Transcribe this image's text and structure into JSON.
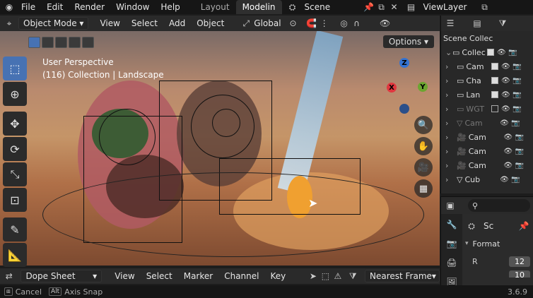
{
  "topbar": {
    "menus": [
      "File",
      "Edit",
      "Render",
      "Window",
      "Help"
    ],
    "workspaces": [
      {
        "label": "Layout",
        "active": false
      },
      {
        "label": "Modelin",
        "active": true
      }
    ],
    "scene": "Scene",
    "view_layer": "ViewLayer"
  },
  "viewport_header": {
    "mode": "Object Mode",
    "menus": [
      "View",
      "Select",
      "Add",
      "Object"
    ],
    "orientation": "Global",
    "options_label": "Options"
  },
  "viewport": {
    "perspective": "User Perspective",
    "collection_info": "(116) Collection | Landscape",
    "gizmo": {
      "z": "Z",
      "x": "X",
      "y": "Y"
    }
  },
  "outliner": {
    "title": "Scene Collec",
    "rows": [
      {
        "name": "Collectio",
        "icon": "collection-icon",
        "checked": true,
        "dim": false
      },
      {
        "name": "Cam",
        "icon": "collection-icon",
        "checked": true,
        "dim": false
      },
      {
        "name": "Cha",
        "icon": "collection-icon",
        "checked": true,
        "dim": false
      },
      {
        "name": "Lan",
        "icon": "collection-icon",
        "checked": true,
        "dim": false
      },
      {
        "name": "WGT",
        "icon": "collection-icon",
        "checked": false,
        "dim": true
      },
      {
        "name": "Cam",
        "icon": "mesh-icon",
        "checked": false,
        "dim": true
      },
      {
        "name": "Cam",
        "icon": "camera-icon",
        "checked": false,
        "dim": false
      },
      {
        "name": "Cam",
        "icon": "camera-icon",
        "checked": false,
        "dim": false
      },
      {
        "name": "Cam",
        "icon": "camera-icon",
        "checked": false,
        "dim": false
      },
      {
        "name": "Cub",
        "icon": "mesh-icon",
        "checked": false,
        "dim": false
      }
    ]
  },
  "properties": {
    "scene_label": "Sc",
    "format_label": "Format",
    "res_label": "R",
    "res_value": "12",
    "res_value2": "10"
  },
  "dopesheet_header": {
    "editor": "Dope Sheet",
    "menus": [
      "View",
      "Select",
      "Marker",
      "Channel",
      "Key"
    ],
    "snap": "Nearest Frame"
  },
  "status": {
    "cancel": "Cancel",
    "alt_key": "Alt",
    "axis_snap": "Axis Snap",
    "version": "3.6.9"
  },
  "colors": {
    "accent": "#4772b3",
    "gizmo_x": "#e0373f",
    "gizmo_y": "#6ca530",
    "gizmo_z": "#3473d1"
  }
}
